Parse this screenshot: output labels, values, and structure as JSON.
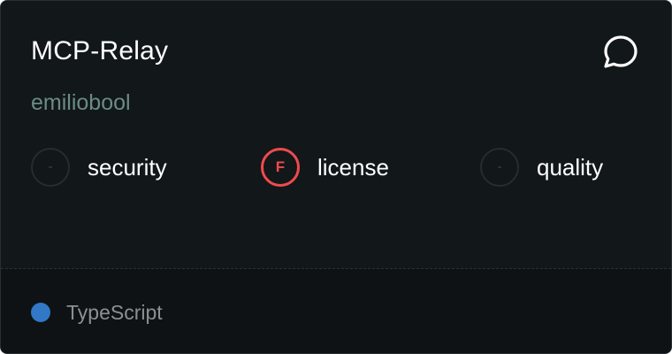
{
  "card": {
    "title": "MCP-Relay",
    "author": "emiliobool",
    "chat_icon": "speech-bubble-icon",
    "scores": [
      {
        "label": "security",
        "grade": "-",
        "status_color": "#3b4347"
      },
      {
        "label": "license",
        "grade": "F",
        "status_color": "#f04a4f"
      },
      {
        "label": "quality",
        "grade": "-",
        "status_color": "#3b4347"
      }
    ],
    "language": {
      "name": "TypeScript",
      "color": "#3178c6"
    }
  }
}
